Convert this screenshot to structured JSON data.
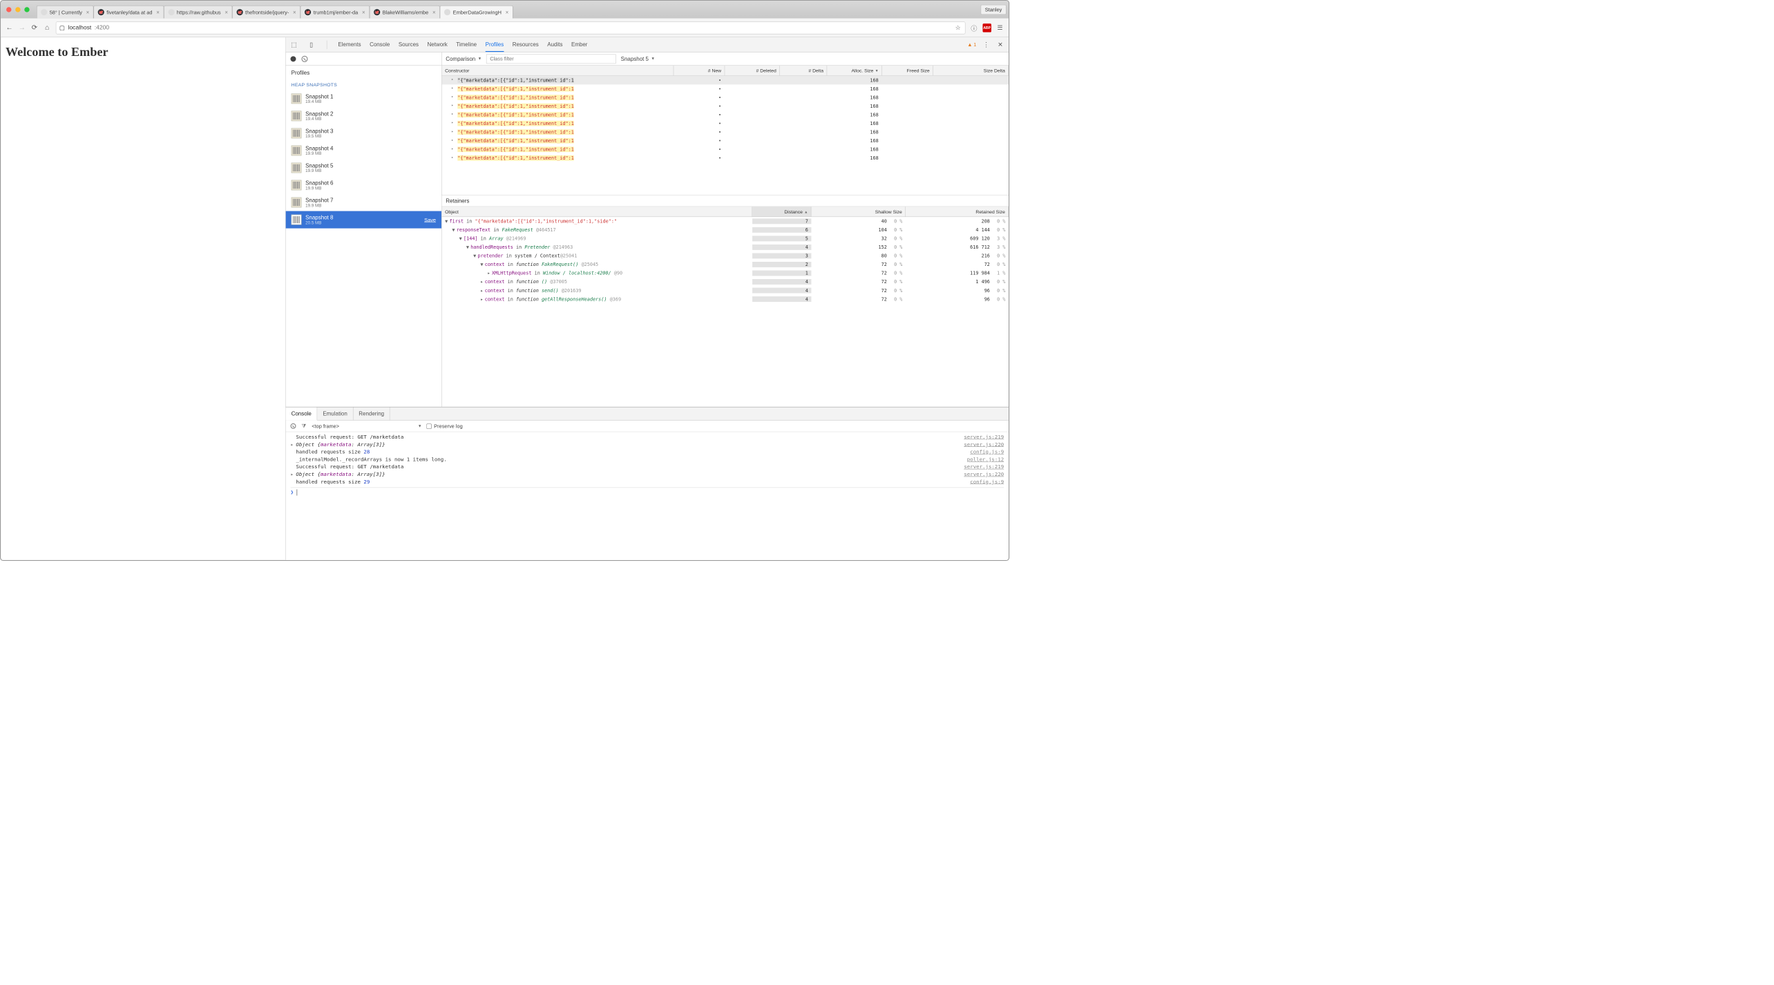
{
  "browser": {
    "profile": "Stanley",
    "tabs": [
      {
        "label": "58° | Currently",
        "fav": ""
      },
      {
        "label": "fivetanley/data at ad",
        "fav": "gh"
      },
      {
        "label": "https://raw.githubus",
        "fav": ""
      },
      {
        "label": "thefrontside/jquery-",
        "fav": "gh"
      },
      {
        "label": "trumb1mj/ember-da",
        "fav": "gh"
      },
      {
        "label": "BlakeWilliams/embe",
        "fav": "gh"
      },
      {
        "label": "EmberDataGrowingH",
        "fav": "",
        "active": true
      }
    ],
    "url_host": "localhost",
    "url_path": ":4200"
  },
  "page": {
    "heading": "Welcome to Ember"
  },
  "devtools": {
    "tabs": [
      "Elements",
      "Console",
      "Sources",
      "Network",
      "Timeline",
      "Profiles",
      "Resources",
      "Audits",
      "Ember"
    ],
    "active_tab": "Profiles",
    "warn_count": "1",
    "left": {
      "profiles_title": "Profiles",
      "heap_title": "HEAP SNAPSHOTS",
      "snapshots": [
        {
          "name": "Snapshot 1",
          "size": "19.4 MB"
        },
        {
          "name": "Snapshot 2",
          "size": "19.4 MB"
        },
        {
          "name": "Snapshot 3",
          "size": "19.5 MB"
        },
        {
          "name": "Snapshot 4",
          "size": "19.9 MB"
        },
        {
          "name": "Snapshot 5",
          "size": "19.9 MB"
        },
        {
          "name": "Snapshot 6",
          "size": "19.9 MB"
        },
        {
          "name": "Snapshot 7",
          "size": "19.9 MB"
        },
        {
          "name": "Snapshot 8",
          "size": "20.5 MB",
          "active": true,
          "save": "Save"
        }
      ]
    },
    "top": {
      "view": "Comparison",
      "filter_placeholder": "Class filter",
      "baseline": "Snapshot 5"
    },
    "constructor_table": {
      "headers": [
        "Constructor",
        "# New",
        "# Deleted",
        "# Delta",
        "Alloc. Size",
        "Freed Size",
        "Size Delta"
      ],
      "rows": [
        {
          "text": "\"{\"marketdata\":[{\"id\":1,\"instrument_id\":1",
          "alloc": "168",
          "sel": true
        },
        {
          "text": "\"{\"marketdata\":[{\"id\":1,\"instrument_id\":1",
          "alloc": "168"
        },
        {
          "text": "\"{\"marketdata\":[{\"id\":1,\"instrument_id\":1",
          "alloc": "168"
        },
        {
          "text": "\"{\"marketdata\":[{\"id\":1,\"instrument_id\":1",
          "alloc": "168"
        },
        {
          "text": "\"{\"marketdata\":[{\"id\":1,\"instrument_id\":1",
          "alloc": "168"
        },
        {
          "text": "\"{\"marketdata\":[{\"id\":1,\"instrument_id\":1",
          "alloc": "168"
        },
        {
          "text": "\"{\"marketdata\":[{\"id\":1,\"instrument_id\":1",
          "alloc": "168"
        },
        {
          "text": "\"{\"marketdata\":[{\"id\":1,\"instrument_id\":1",
          "alloc": "168"
        },
        {
          "text": "\"{\"marketdata\":[{\"id\":1,\"instrument_id\":1",
          "alloc": "168"
        },
        {
          "text": "\"{\"marketdata\":[{\"id\":1,\"instrument_id\":1",
          "alloc": "168"
        }
      ]
    },
    "retainers": {
      "title": "Retainers",
      "headers": [
        "Object",
        "Distance",
        "Shallow Size",
        "Retained Size"
      ],
      "rows": [
        {
          "indent": 0,
          "disc": "▼",
          "prop": "first",
          "in": "in",
          "rest": "\"{\"marketdata\":[{\"id\":1,\"instrument_id\":1,\"side\":\"",
          "dist": "7",
          "shallow": "40",
          "shallow_pct": "0 %",
          "ret": "208",
          "ret_pct": "0 %"
        },
        {
          "indent": 1,
          "disc": "▼",
          "prop": "responseText",
          "in": "in",
          "cls": "FakeRequest",
          "oid": "@464517",
          "dist": "6",
          "shallow": "104",
          "shallow_pct": "0 %",
          "ret": "4 144",
          "ret_pct": "0 %"
        },
        {
          "indent": 2,
          "disc": "▼",
          "prop": "[144]",
          "in": "in",
          "cls": "Array",
          "oid": "@214969",
          "dist": "5",
          "shallow": "32",
          "shallow_pct": "0 %",
          "ret": "609 120",
          "ret_pct": "3 %"
        },
        {
          "indent": 3,
          "disc": "▼",
          "prop": "handledRequests",
          "in": "in",
          "cls": "Pretender",
          "oid": "@214963",
          "dist": "4",
          "shallow": "152",
          "shallow_pct": "0 %",
          "ret": "616 712",
          "ret_pct": "3 %"
        },
        {
          "indent": 4,
          "disc": "▼",
          "prop": "pretender",
          "in": "in",
          "sys": "system / Context",
          "oid": "@25041",
          "dist": "3",
          "shallow": "80",
          "shallow_pct": "0 %",
          "ret": "216",
          "ret_pct": "0 %"
        },
        {
          "indent": 5,
          "disc": "▼",
          "prop": "context",
          "in": "in",
          "func": "function",
          "cls": "FakeRequest()",
          "oid": "@25045",
          "dist": "2",
          "shallow": "72",
          "shallow_pct": "0 %",
          "ret": "72",
          "ret_pct": "0 %"
        },
        {
          "indent": 6,
          "disc": "▸",
          "prop": "XMLHttpRequest",
          "in": "in",
          "cls": "Window / localhost:4200/",
          "oid": "@90",
          "dist": "1",
          "shallow": "72",
          "shallow_pct": "0 %",
          "ret": "119 984",
          "ret_pct": "1 %"
        },
        {
          "indent": 5,
          "disc": "▸",
          "prop": "context",
          "in": "in",
          "func": "function",
          "cls": "()",
          "oid": "@37005",
          "dist": "4",
          "shallow": "72",
          "shallow_pct": "0 %",
          "ret": "1 496",
          "ret_pct": "0 %"
        },
        {
          "indent": 5,
          "disc": "▸",
          "prop": "context",
          "in": "in",
          "func": "function",
          "cls": "send()",
          "oid": "@201639",
          "dist": "4",
          "shallow": "72",
          "shallow_pct": "0 %",
          "ret": "96",
          "ret_pct": "0 %"
        },
        {
          "indent": 5,
          "disc": "▸",
          "prop": "context",
          "in": "in",
          "func": "function",
          "cls": "getAllResponseHeaders()",
          "oid": "@369",
          "dist": "4",
          "shallow": "72",
          "shallow_pct": "0 %",
          "ret": "96",
          "ret_pct": "0 %"
        }
      ]
    }
  },
  "drawer": {
    "tabs": [
      "Console",
      "Emulation",
      "Rendering"
    ],
    "frame": "<top frame>",
    "preserve_label": "Preserve log",
    "lines": [
      {
        "type": "plain",
        "text": "Successful request: GET /marketdata",
        "src": "server.js:219"
      },
      {
        "type": "obj",
        "pre": "Object {",
        "prop": "marketdata",
        "rest": ": Array[3]}",
        "src": "server.js:220"
      },
      {
        "type": "num",
        "text": "handled requests size ",
        "num": "28",
        "src": "config.js:9"
      },
      {
        "type": "plain",
        "text": "_internalModel._recordArrays is now 1 items long.",
        "src": "poller.js:12"
      },
      {
        "type": "plain",
        "text": "Successful request: GET /marketdata",
        "src": "server.js:219"
      },
      {
        "type": "obj",
        "pre": "Object {",
        "prop": "marketdata",
        "rest": ": Array[3]}",
        "src": "server.js:220"
      },
      {
        "type": "num",
        "text": "handled requests size ",
        "num": "29",
        "src": "config.js:9"
      }
    ]
  }
}
